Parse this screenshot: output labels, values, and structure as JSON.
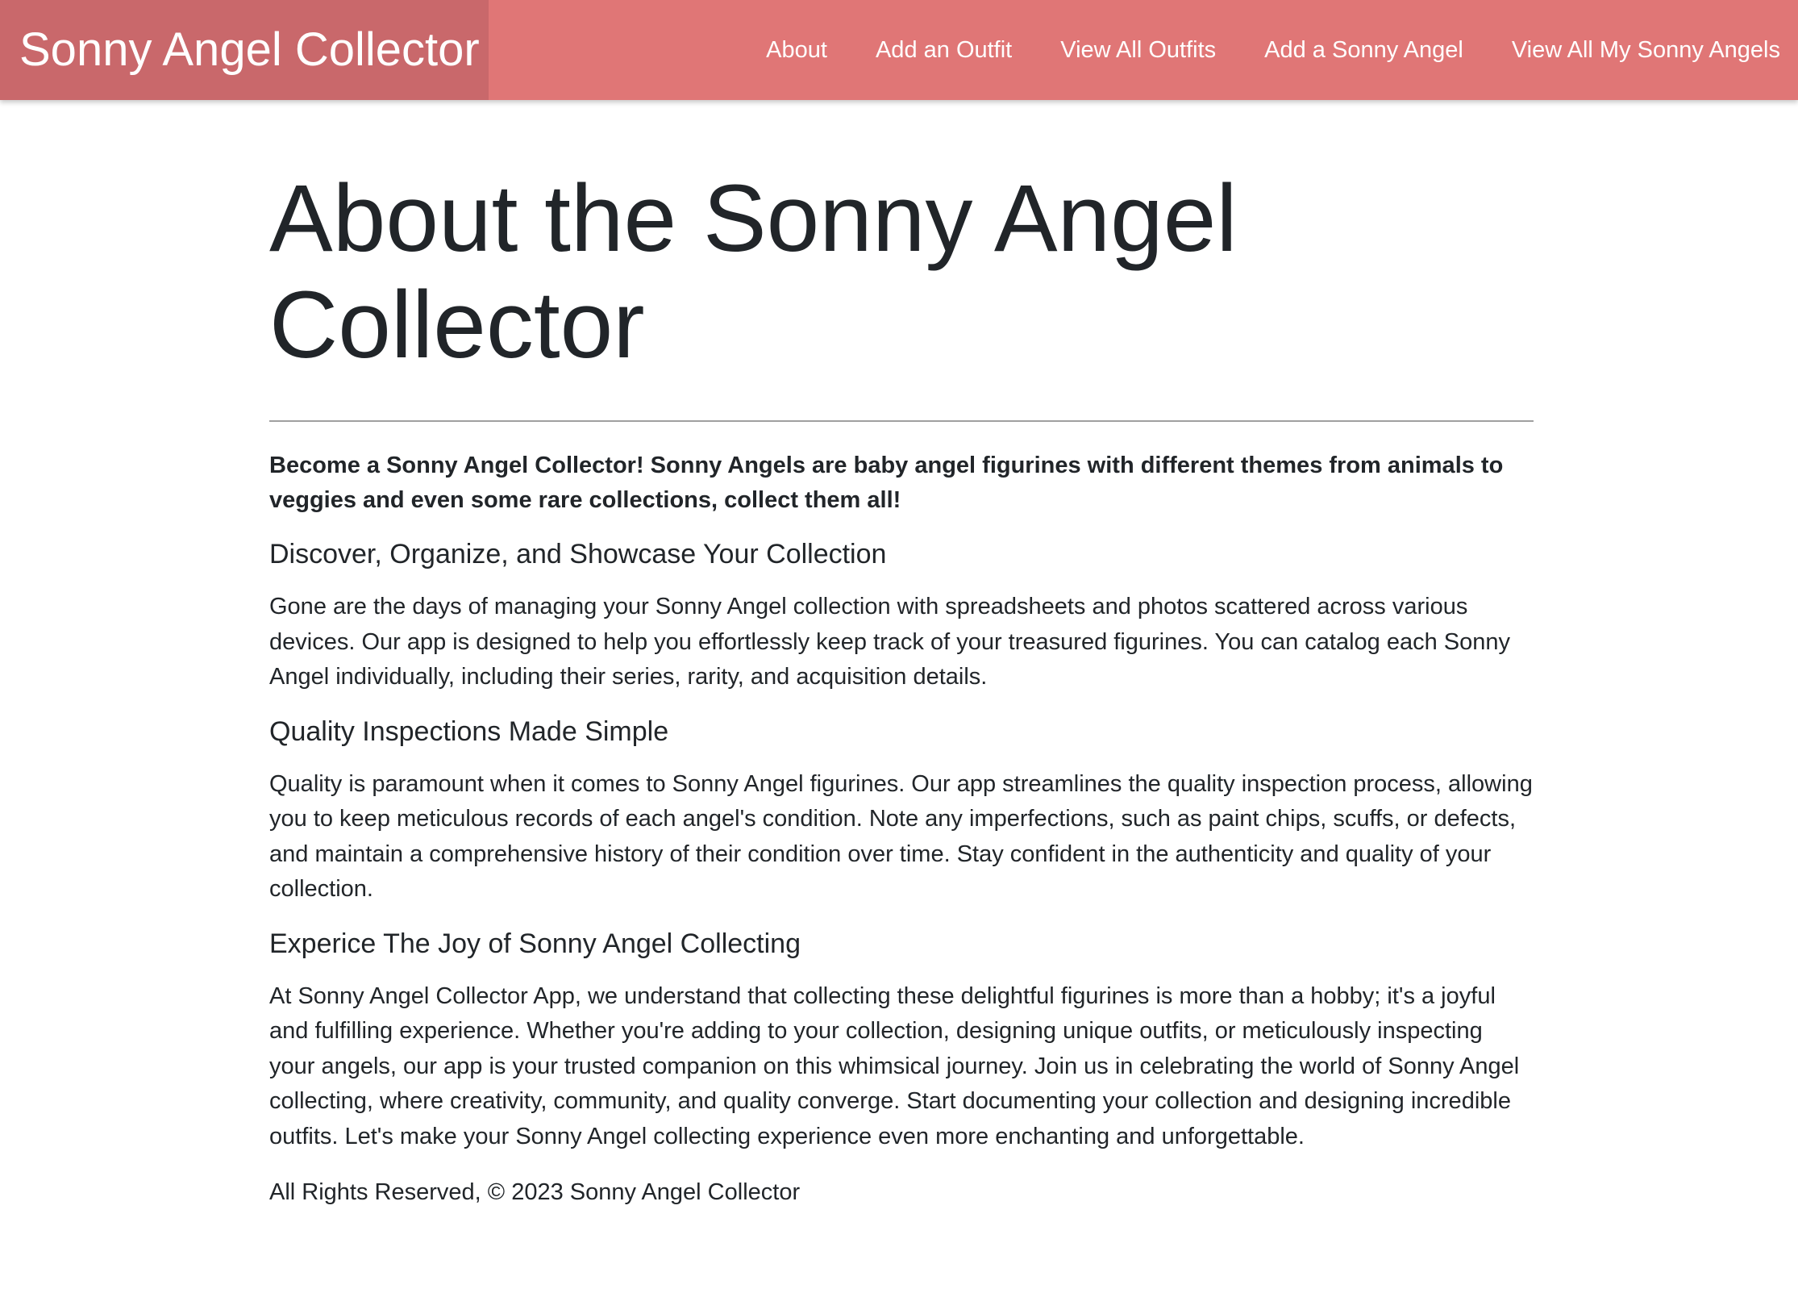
{
  "navbar": {
    "brand": "Sonny Angel Collector",
    "links": [
      {
        "label": "About"
      },
      {
        "label": "Add an Outfit"
      },
      {
        "label": "View All Outfits"
      },
      {
        "label": "Add a Sonny Angel"
      },
      {
        "label": "View All My Sonny Angels"
      }
    ],
    "colors": {
      "background": "#e07676",
      "brand_background": "#c9686b",
      "text": "#ffffff"
    }
  },
  "main": {
    "title": "About the Sonny Angel Collector",
    "lead": "Become a Sonny Angel Collector! Sonny Angels are baby angel figurines with different themes from animals to veggies and even some rare collections, collect them all!",
    "sections": [
      {
        "heading": "Discover, Organize, and Showcase Your Collection",
        "body": "Gone are the days of managing your Sonny Angel collection with spreadsheets and photos scattered across various devices. Our app is designed to help you effortlessly keep track of your treasured figurines. You can catalog each Sonny Angel individually, including their series, rarity, and acquisition details."
      },
      {
        "heading": "Quality Inspections Made Simple",
        "body": "Quality is paramount when it comes to Sonny Angel figurines. Our app streamlines the quality inspection process, allowing you to keep meticulous records of each angel's condition. Note any imperfections, such as paint chips, scuffs, or defects, and maintain a comprehensive history of their condition over time. Stay confident in the authenticity and quality of your collection."
      },
      {
        "heading": "Experice The Joy of Sonny Angel Collecting",
        "body": "At Sonny Angel Collector App, we understand that collecting these delightful figurines is more than a hobby; it's a joyful and fulfilling experience. Whether you're adding to your collection, designing unique outfits, or meticulously inspecting your angels, our app is your trusted companion on this whimsical journey. Join us in celebrating the world of Sonny Angel collecting, where creativity, community, and quality converge. Start documenting your collection and designing incredible outfits. Let's make your Sonny Angel collecting experience even more enchanting and unforgettable."
      }
    ],
    "footer": "All Rights Reserved, © 2023 Sonny Angel Collector"
  }
}
